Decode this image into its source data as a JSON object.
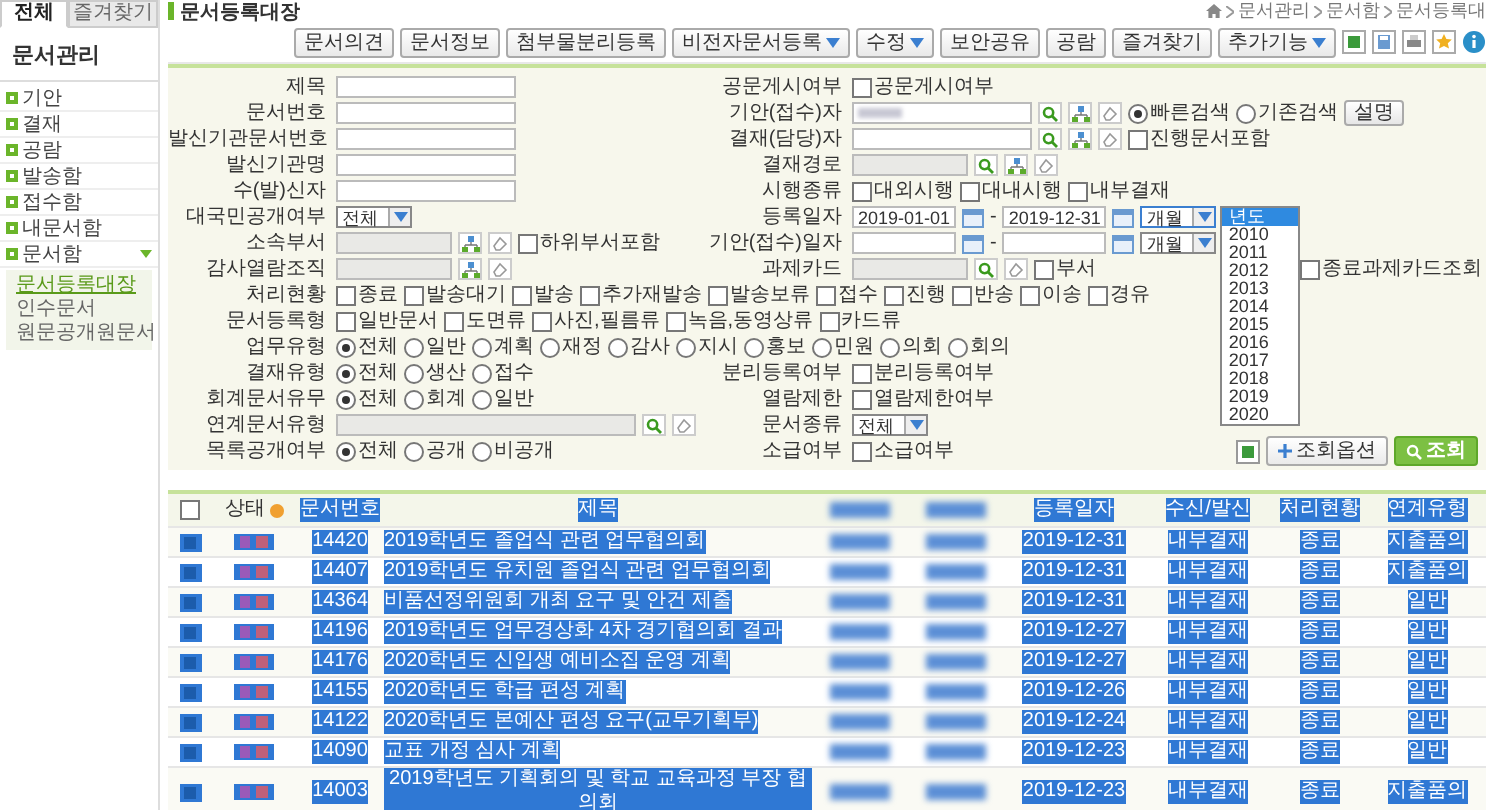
{
  "sidebar": {
    "tabs": [
      {
        "label": "전체",
        "selected": true
      },
      {
        "label": "즐겨찾기",
        "selected": false
      }
    ],
    "title": "문서관리",
    "items": [
      {
        "label": "기안",
        "expanded": false
      },
      {
        "label": "결재",
        "expanded": false
      },
      {
        "label": "공람",
        "expanded": false
      },
      {
        "label": "발송함",
        "expanded": false
      },
      {
        "label": "접수함",
        "expanded": false
      },
      {
        "label": "내문서함",
        "expanded": false
      },
      {
        "label": "문서함",
        "expanded": true,
        "children": [
          {
            "label": "문서등록대장",
            "selected": true
          },
          {
            "label": "인수문서",
            "selected": false
          },
          {
            "label": "원문공개원문서",
            "selected": false
          }
        ]
      }
    ]
  },
  "page": {
    "title": "문서등록대장",
    "breadcrumb": [
      "문서관리",
      "문서함",
      "문서등록대"
    ]
  },
  "toolbar": {
    "buttons": [
      {
        "label": "문서의견",
        "dropdown": false
      },
      {
        "label": "문서정보",
        "dropdown": false
      },
      {
        "label": "첨부물분리등록",
        "dropdown": false
      },
      {
        "label": "비전자문서등록",
        "dropdown": true
      },
      {
        "label": "수정",
        "dropdown": true
      },
      {
        "label": "보안공유",
        "dropdown": false
      },
      {
        "label": "공람",
        "dropdown": false
      },
      {
        "label": "즐겨찾기",
        "dropdown": false
      },
      {
        "label": "추가기능",
        "dropdown": true
      }
    ]
  },
  "search_form": {
    "rows": [
      {
        "cells": [
          {
            "label": "제목",
            "controls": [
              {
                "kind": "input",
                "disabled": false
              }
            ]
          },
          {
            "label": "공문게시여부",
            "controls": [
              {
                "kind": "checkbox",
                "label": "공문게시여부",
                "checked": false
              }
            ]
          }
        ]
      },
      {
        "cells": [
          {
            "label": "문서번호",
            "controls": [
              {
                "kind": "input",
                "disabled": false
              }
            ]
          },
          {
            "label": "기안(접수)자",
            "controls": [
              {
                "kind": "input",
                "disabled": false,
                "redacted": true
              },
              {
                "kind": "search"
              },
              {
                "kind": "org"
              },
              {
                "kind": "clear"
              },
              {
                "kind": "radio",
                "label": "빠른검색",
                "selected": true
              },
              {
                "kind": "radio",
                "label": "기존검색",
                "selected": false
              },
              {
                "kind": "button",
                "label": "설명"
              }
            ]
          }
        ]
      },
      {
        "cells": [
          {
            "label": "발신기관문서번호",
            "controls": [
              {
                "kind": "input",
                "disabled": false
              }
            ]
          },
          {
            "label": "결재(담당)자",
            "controls": [
              {
                "kind": "input",
                "disabled": false
              },
              {
                "kind": "search"
              },
              {
                "kind": "org"
              },
              {
                "kind": "clear"
              },
              {
                "kind": "checkbox",
                "label": "진행문서포함",
                "checked": false
              }
            ]
          }
        ]
      },
      {
        "cells": [
          {
            "label": "발신기관명",
            "controls": [
              {
                "kind": "input",
                "disabled": false
              }
            ]
          },
          {
            "label": "결재경로",
            "controls": [
              {
                "kind": "input",
                "disabled": true
              },
              {
                "kind": "search"
              },
              {
                "kind": "org"
              },
              {
                "kind": "clear"
              }
            ]
          }
        ]
      },
      {
        "cells": [
          {
            "label": "수(발)신자",
            "controls": [
              {
                "kind": "input",
                "disabled": false
              }
            ]
          },
          {
            "label": "시행종류",
            "controls": [
              {
                "kind": "checkbox",
                "label": "대외시행",
                "checked": false
              },
              {
                "kind": "checkbox",
                "label": "대내시행",
                "checked": false
              },
              {
                "kind": "checkbox",
                "label": "내부결재",
                "checked": false
              }
            ]
          }
        ]
      },
      {
        "cells": [
          {
            "label": "대국민공개여부",
            "controls": [
              {
                "kind": "select",
                "value": "전체"
              }
            ]
          },
          {
            "label": "등록일자",
            "controls": [
              {
                "kind": "date",
                "value": "2019-01-01"
              },
              {
                "kind": "calendar"
              },
              {
                "kind": "text",
                "text": "-"
              },
              {
                "kind": "date",
                "value": "2019-12-31"
              },
              {
                "kind": "calendar"
              },
              {
                "kind": "select",
                "value": "개월",
                "open": true
              }
            ]
          }
        ]
      },
      {
        "cells": [
          {
            "label": "소속부서",
            "controls": [
              {
                "kind": "input",
                "disabled": true
              },
              {
                "kind": "org"
              },
              {
                "kind": "clear"
              },
              {
                "kind": "checkbox",
                "label": "하위부서포함",
                "checked": false
              }
            ]
          },
          {
            "label": "기안(접수)일자",
            "controls": [
              {
                "kind": "date"
              },
              {
                "kind": "calendar"
              },
              {
                "kind": "text",
                "text": "-"
              },
              {
                "kind": "date"
              },
              {
                "kind": "calendar"
              },
              {
                "kind": "select",
                "value": "개월"
              }
            ]
          }
        ]
      },
      {
        "cells": [
          {
            "label": "감사열람조직",
            "controls": [
              {
                "kind": "input",
                "disabled": true
              },
              {
                "kind": "org"
              },
              {
                "kind": "clear"
              }
            ]
          },
          {
            "label": "과제카드",
            "controls": [
              {
                "kind": "input",
                "disabled": true
              },
              {
                "kind": "search"
              },
              {
                "kind": "clear"
              },
              {
                "kind": "checkbox",
                "label": "부서",
                "checked": false
              },
              {
                "kind": "checkbox",
                "label": "종료과제카드조회",
                "checked": false
              }
            ]
          }
        ]
      },
      {
        "cells": [
          {
            "label": "처리현황",
            "controls": [
              {
                "kind": "checkbox",
                "label": "종료",
                "checked": false
              },
              {
                "kind": "checkbox",
                "label": "발송대기",
                "checked": false
              },
              {
                "kind": "checkbox",
                "label": "발송",
                "checked": false
              },
              {
                "kind": "checkbox",
                "label": "추가재발송",
                "checked": false
              },
              {
                "kind": "checkbox",
                "label": "발송보류",
                "checked": false
              },
              {
                "kind": "checkbox",
                "label": "접수",
                "checked": false
              },
              {
                "kind": "checkbox",
                "label": "진행",
                "checked": false
              },
              {
                "kind": "checkbox",
                "label": "반송",
                "checked": false
              },
              {
                "kind": "checkbox",
                "label": "이송",
                "checked": false
              },
              {
                "kind": "checkbox",
                "label": "경유",
                "checked": false
              }
            ]
          }
        ]
      },
      {
        "cells": [
          {
            "label": "문서등록형",
            "controls": [
              {
                "kind": "checkbox",
                "label": "일반문서",
                "checked": false
              },
              {
                "kind": "checkbox",
                "label": "도면류",
                "checked": false
              },
              {
                "kind": "checkbox",
                "label": "사진,필름류",
                "checked": false
              },
              {
                "kind": "checkbox",
                "label": "녹음,동영상류",
                "checked": false
              },
              {
                "kind": "checkbox",
                "label": "카드류",
                "checked": false
              }
            ]
          }
        ]
      },
      {
        "cells": [
          {
            "label": "업무유형",
            "controls": [
              {
                "kind": "radio",
                "label": "전체",
                "selected": true
              },
              {
                "kind": "radio",
                "label": "일반",
                "selected": false
              },
              {
                "kind": "radio",
                "label": "계획",
                "selected": false
              },
              {
                "kind": "radio",
                "label": "재정",
                "selected": false
              },
              {
                "kind": "radio",
                "label": "감사",
                "selected": false
              },
              {
                "kind": "radio",
                "label": "지시",
                "selected": false
              },
              {
                "kind": "radio",
                "label": "홍보",
                "selected": false
              },
              {
                "kind": "radio",
                "label": "민원",
                "selected": false
              },
              {
                "kind": "radio",
                "label": "의회",
                "selected": false
              },
              {
                "kind": "radio",
                "label": "회의",
                "selected": false
              }
            ]
          }
        ]
      },
      {
        "cells": [
          {
            "label": "결재유형",
            "controls": [
              {
                "kind": "radio",
                "label": "전체",
                "selected": true
              },
              {
                "kind": "radio",
                "label": "생산",
                "selected": false
              },
              {
                "kind": "radio",
                "label": "접수",
                "selected": false
              }
            ]
          },
          {
            "label": "분리등록여부",
            "controls": [
              {
                "kind": "checkbox",
                "label": "분리등록여부",
                "checked": false
              }
            ]
          }
        ]
      },
      {
        "cells": [
          {
            "label": "회계문서유무",
            "controls": [
              {
                "kind": "radio",
                "label": "전체",
                "selected": true
              },
              {
                "kind": "radio",
                "label": "회계",
                "selected": false
              },
              {
                "kind": "radio",
                "label": "일반",
                "selected": false
              }
            ]
          },
          {
            "label": "열람제한",
            "controls": [
              {
                "kind": "checkbox",
                "label": "열람제한여부",
                "checked": false
              }
            ]
          }
        ]
      },
      {
        "cells": [
          {
            "label": "연계문서유형",
            "controls": [
              {
                "kind": "input",
                "disabled": true
              },
              {
                "kind": "search"
              },
              {
                "kind": "clear"
              }
            ]
          },
          {
            "label": "문서종류",
            "controls": [
              {
                "kind": "select",
                "value": "전체"
              }
            ]
          }
        ]
      },
      {
        "cells": [
          {
            "label": "목록공개여부",
            "controls": [
              {
                "kind": "radio",
                "label": "전체",
                "selected": true
              },
              {
                "kind": "radio",
                "label": "공개",
                "selected": false
              },
              {
                "kind": "radio",
                "label": "비공개",
                "selected": false
              }
            ]
          },
          {
            "label": "소급여부",
            "controls": [
              {
                "kind": "checkbox",
                "label": "소급여부",
                "checked": false
              }
            ]
          }
        ]
      }
    ],
    "open_list": {
      "options": [
        {
          "label": "년도",
          "selected": true
        },
        {
          "label": "2010",
          "selected": false
        },
        {
          "label": "2011",
          "selected": false
        },
        {
          "label": "2012",
          "selected": false
        },
        {
          "label": "2013",
          "selected": false
        },
        {
          "label": "2014",
          "selected": false
        },
        {
          "label": "2015",
          "selected": false
        },
        {
          "label": "2016",
          "selected": false
        },
        {
          "label": "2017",
          "selected": false
        },
        {
          "label": "2018",
          "selected": false
        },
        {
          "label": "2019",
          "selected": false
        },
        {
          "label": "2020",
          "selected": false
        }
      ]
    },
    "actions": [
      {
        "label": "조회옵션",
        "primary": false
      },
      {
        "label": "조회",
        "primary": true
      }
    ]
  },
  "table": {
    "text_selected": true,
    "header_checked": false,
    "columns": [
      {
        "kind": "text",
        "label": "상태"
      },
      {
        "kind": "text",
        "label": "문서번호"
      },
      {
        "kind": "text",
        "label": "제목"
      },
      {
        "kind": "redacted"
      },
      {
        "kind": "redacted"
      },
      {
        "kind": "text",
        "label": "등록일자"
      },
      {
        "kind": "text",
        "label": "수신/발신"
      },
      {
        "kind": "text",
        "label": "처리현황"
      },
      {
        "kind": "text",
        "label": "연계유형"
      }
    ],
    "rows": [
      {
        "number": "14420",
        "title": "2019학년도 졸업식 관련 업무협의회",
        "date": "2019-12-31",
        "direction": "내부결재",
        "status": "종료",
        "link_type": "지출품의"
      },
      {
        "number": "14407",
        "title": "2019학년도 유치원 졸업식 관련 업무협의회",
        "date": "2019-12-31",
        "direction": "내부결재",
        "status": "종료",
        "link_type": "지출품의"
      },
      {
        "number": "14364",
        "title": "비품선정위원회 개최 요구 및 안건 제출",
        "date": "2019-12-31",
        "direction": "내부결재",
        "status": "종료",
        "link_type": "일반"
      },
      {
        "number": "14196",
        "title": "2019학년도 업무경상화 4차 경기협의회 결과",
        "date": "2019-12-27",
        "direction": "내부결재",
        "status": "종료",
        "link_type": "일반"
      },
      {
        "number": "14176",
        "title": "2020학년도 신입생 예비소집 운영 계획",
        "date": "2019-12-27",
        "direction": "내부결재",
        "status": "종료",
        "link_type": "일반"
      },
      {
        "number": "14155",
        "title": "2020학년도 학급 편성 계획",
        "date": "2019-12-26",
        "direction": "내부결재",
        "status": "종료",
        "link_type": "일반"
      },
      {
        "number": "14122",
        "title": "2020학년도 본예산 편성 요구(교무기획부)",
        "date": "2019-12-24",
        "direction": "내부결재",
        "status": "종료",
        "link_type": "일반"
      },
      {
        "number": "14090",
        "title": "교표 개정 심사 계획",
        "date": "2019-12-23",
        "direction": "내부결재",
        "status": "종료",
        "link_type": "일반"
      },
      {
        "number": "14003",
        "title": "2019학년도 기획회의 및 학교 교육과정 부장 협의회",
        "date": "2019-12-23",
        "direction": "내부결재",
        "status": "종료",
        "link_type": "지출품의"
      }
    ]
  }
}
